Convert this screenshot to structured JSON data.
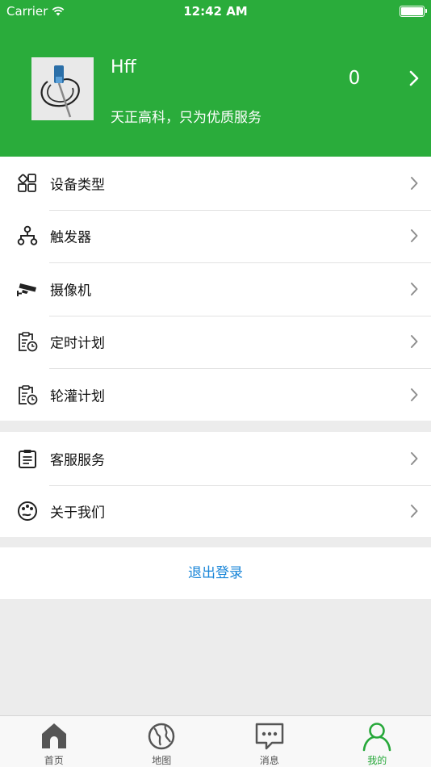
{
  "status_bar": {
    "carrier": "Carrier",
    "time": "12:42 AM"
  },
  "profile": {
    "name": "Hff",
    "slogan": "天正高科，只为优质服务",
    "count": "0"
  },
  "menu_group_1": [
    {
      "label": "设备类型",
      "icon": "grid-apps-icon"
    },
    {
      "label": "触发器",
      "icon": "hierarchy-icon"
    },
    {
      "label": "摄像机",
      "icon": "camera-icon"
    },
    {
      "label": "定时计划",
      "icon": "clipboard-clock-icon"
    },
    {
      "label": "轮灌计划",
      "icon": "clipboard-clock-icon"
    }
  ],
  "menu_group_2": [
    {
      "label": "客服服务",
      "icon": "clipboard-list-icon"
    },
    {
      "label": "关于我们",
      "icon": "palette-icon"
    }
  ],
  "logout_label": "退出登录",
  "tabs": [
    {
      "label": "首页",
      "icon": "home-icon"
    },
    {
      "label": "地图",
      "icon": "globe-icon"
    },
    {
      "label": "消息",
      "icon": "message-icon"
    },
    {
      "label": "我的",
      "icon": "person-icon",
      "active": true
    }
  ],
  "colors": {
    "brand_green": "#2aac3b",
    "link_blue": "#1a86d8",
    "background": "#ececec"
  }
}
